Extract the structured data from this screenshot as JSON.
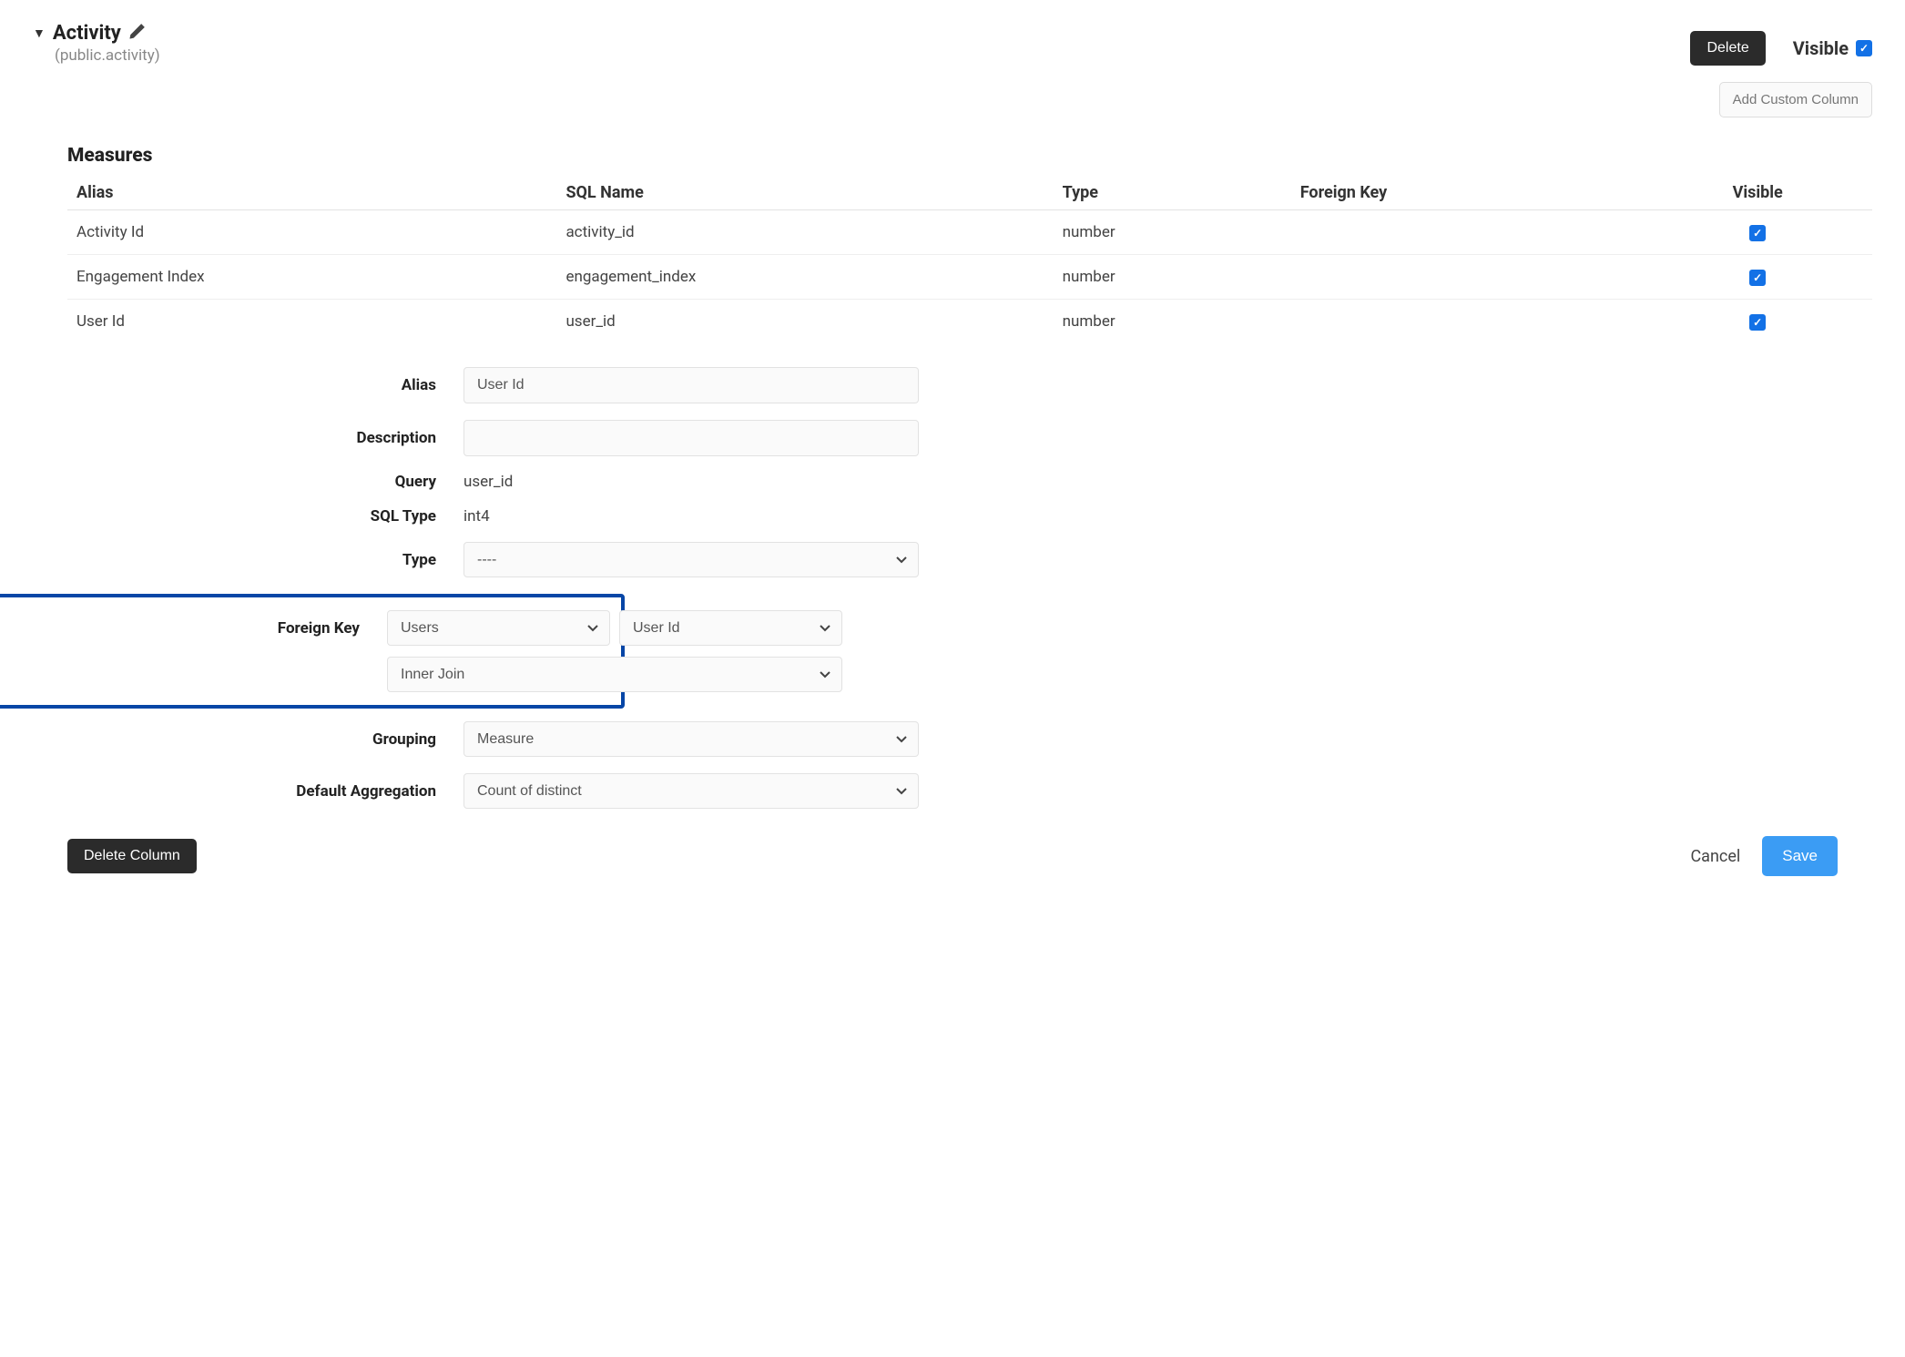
{
  "header": {
    "title": "Activity",
    "subtitle": "(public.activity)",
    "delete_label": "Delete",
    "visible_label": "Visible",
    "visible_checked": true,
    "add_custom_column_label": "Add Custom Column"
  },
  "measures": {
    "section_title": "Measures",
    "columns": {
      "alias": "Alias",
      "sql_name": "SQL Name",
      "type": "Type",
      "foreign_key": "Foreign Key",
      "visible": "Visible"
    },
    "rows": [
      {
        "alias": "Activity Id",
        "sql_name": "activity_id",
        "type": "number",
        "foreign_key": "",
        "visible": true
      },
      {
        "alias": "Engagement Index",
        "sql_name": "engagement_index",
        "type": "number",
        "foreign_key": "",
        "visible": true
      },
      {
        "alias": "User Id",
        "sql_name": "user_id",
        "type": "number",
        "foreign_key": "",
        "visible": true
      }
    ]
  },
  "form": {
    "labels": {
      "alias": "Alias",
      "description": "Description",
      "query": "Query",
      "sql_type": "SQL Type",
      "type": "Type",
      "foreign_key": "Foreign Key",
      "grouping": "Grouping",
      "default_aggregation": "Default Aggregation"
    },
    "values": {
      "alias": "User Id",
      "description": "",
      "query": "user_id",
      "sql_type": "int4",
      "type": "----",
      "fk_table": "Users",
      "fk_column": "User Id",
      "fk_join": "Inner Join",
      "grouping": "Measure",
      "default_aggregation": "Count of distinct"
    }
  },
  "footer": {
    "delete_column_label": "Delete Column",
    "cancel_label": "Cancel",
    "save_label": "Save"
  }
}
